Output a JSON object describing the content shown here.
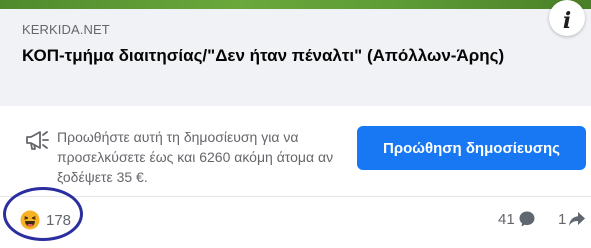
{
  "link_preview": {
    "domain": "KERKIDA.NET",
    "title": "ΚΟΠ-τμήμα διαιτησίας/\"Δεν ήταν πέναλτι\" (Απόλλων-Άρης)"
  },
  "boost": {
    "text": "Προωθήστε αυτή τη δημοσίευση για να προσελκύσετε έως και 6260 ακόμη άτομα αν ξοδέψετε 35 €.",
    "button_label": "Προώθηση δημοσίευσης"
  },
  "reactions": {
    "icon": "haha-reaction-icon",
    "count": "178"
  },
  "comments": {
    "count": "41",
    "icon": "comment-icon"
  },
  "shares": {
    "count": "1",
    "icon": "share-icon"
  },
  "colors": {
    "accent": "#1877f2",
    "preview_bg": "#f0f2f5",
    "highlight_annotation": "#2a2e9e"
  }
}
